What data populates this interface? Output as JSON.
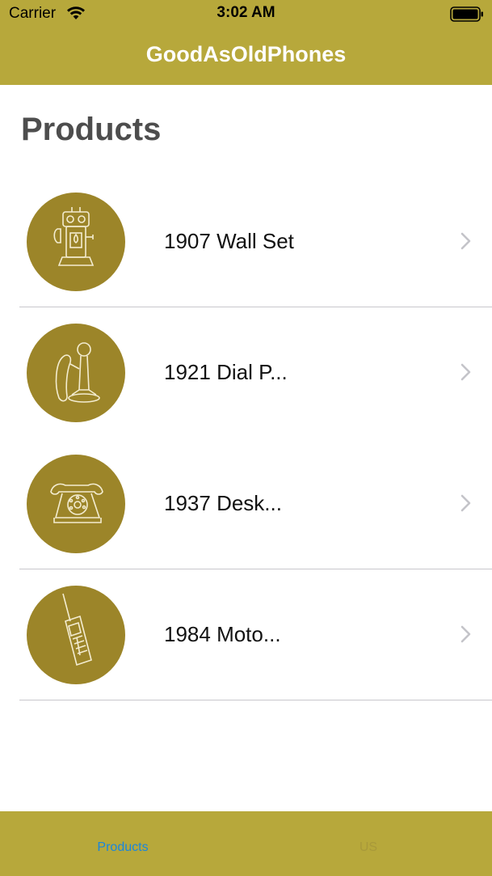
{
  "status_bar": {
    "carrier": "Carrier",
    "time": "3:02 AM"
  },
  "nav": {
    "title": "GoodAsOldPhones"
  },
  "page": {
    "title": "Products"
  },
  "products": [
    {
      "name": "1907 Wall Set",
      "icon": "wall-phone-icon"
    },
    {
      "name": "1921 Dial P...",
      "icon": "candlestick-phone-icon"
    },
    {
      "name": "1937 Desk...",
      "icon": "rotary-desk-phone-icon"
    },
    {
      "name": "1984 Moto...",
      "icon": "brick-mobile-phone-icon"
    }
  ],
  "tabs": {
    "products": "Products",
    "us": "US"
  },
  "colors": {
    "bar": "#b7a83b",
    "thumb": "#9c8529",
    "active_tab": "#1a86dc",
    "inactive_tab": "#a8993a"
  }
}
